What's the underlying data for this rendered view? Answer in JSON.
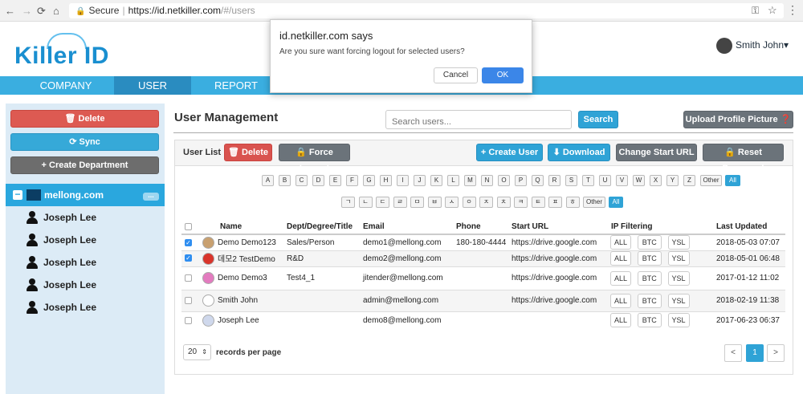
{
  "browser": {
    "secure": "Secure",
    "host": "https://id.netkiller.com",
    "path": "/#/users"
  },
  "brand": {
    "logo": "Killer ID"
  },
  "user": {
    "name": "Smith John▾"
  },
  "nav": {
    "tabs": [
      "COMPANY",
      "USER",
      "REPORT"
    ],
    "active": "USER"
  },
  "sidebar": {
    "delete_label": "Delete",
    "sync_label": "Sync",
    "create_department_label": "Create Department",
    "root": {
      "label": "mellong.com",
      "more": "..."
    },
    "items": [
      "Joseph Lee",
      "Joseph Lee",
      "Joseph Lee",
      "Joseph Lee",
      "Joseph Lee"
    ]
  },
  "main": {
    "title": "User Management",
    "search_placeholder": "Search users...",
    "search_label": "Search",
    "upload_label": "Upload Profile Picture"
  },
  "list": {
    "title": "User List",
    "delete_label": "Delete",
    "force_logout_label": "Force Logout",
    "create_user_label": "Create User",
    "download_label": "Download",
    "change_url_label": "Change Start URL",
    "reset_password_label": "Reset Password"
  },
  "filters": {
    "latin": [
      "A",
      "B",
      "C",
      "D",
      "E",
      "F",
      "G",
      "H",
      "I",
      "J",
      "K",
      "L",
      "M",
      "N",
      "O",
      "P",
      "Q",
      "R",
      "S",
      "T",
      "U",
      "V",
      "W",
      "X",
      "Y",
      "Z",
      "Other",
      "All"
    ],
    "korean": [
      "ㄱ",
      "ㄴ",
      "ㄷ",
      "ㄹ",
      "ㅁ",
      "ㅂ",
      "ㅅ",
      "ㅇ",
      "ㅈ",
      "ㅊ",
      "ㅋ",
      "ㅌ",
      "ㅍ",
      "ㅎ",
      "Other",
      "All"
    ]
  },
  "table": {
    "headers": [
      "Name",
      "Dept/Degree/Title",
      "Email",
      "Phone",
      "Start URL",
      "IP Filtering",
      "Last Updated"
    ],
    "ip_labels": [
      "ALL",
      "BTC",
      "YSL"
    ],
    "rows": [
      {
        "checked": true,
        "name": "Demo Demo123",
        "dept": "Sales/Person",
        "email": "demo1@mellong.com",
        "phone": "180-180-4444",
        "url": "https://drive.google.com",
        "updated": "2018-05-03 07:07"
      },
      {
        "checked": true,
        "name": "데모2 TestDemo",
        "dept": "R&D",
        "email": "demo2@mellong.com",
        "phone": "",
        "url": "https://drive.google.com",
        "updated": "2018-05-01 06:48"
      },
      {
        "checked": false,
        "name": "Demo Demo3",
        "dept": "Test4_1",
        "email": "jitender@mellong.com",
        "phone": "",
        "url": "https://drive.google.com",
        "updated": "2017-01-12 11:02"
      },
      {
        "checked": false,
        "name": "Smith John",
        "dept": "",
        "email": "admin@mellong.com",
        "phone": "",
        "url": "https://drive.google.com",
        "updated": "2018-02-19 11:38"
      },
      {
        "checked": false,
        "name": "Joseph Lee",
        "dept": "",
        "email": "demo8@mellong.com",
        "phone": "",
        "url": "",
        "updated": "2017-06-23 06:37"
      }
    ]
  },
  "pagination": {
    "per_page": "20",
    "per_page_label": "records per page",
    "prev": "<",
    "current": "1",
    "next": ">"
  },
  "dialog": {
    "title": "id.netkiller.com says",
    "message": "Are you sure want forcing logout for selected users?",
    "cancel": "Cancel",
    "ok": "OK"
  }
}
